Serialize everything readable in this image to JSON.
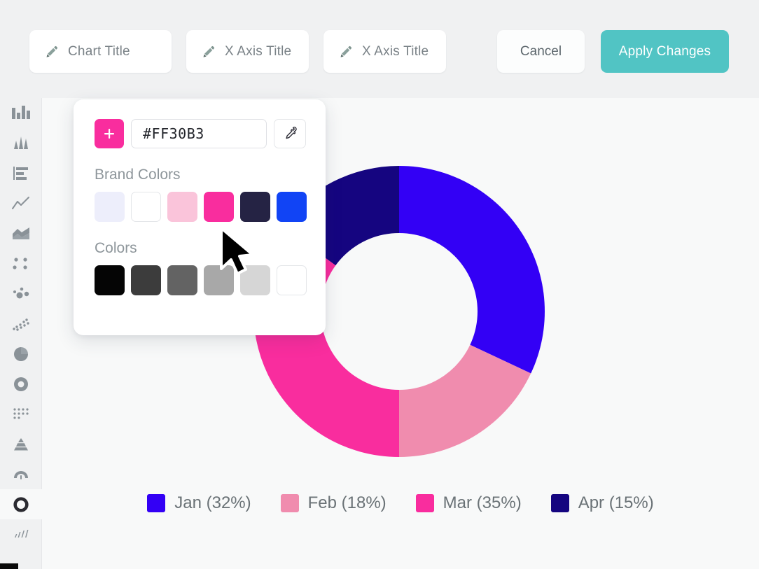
{
  "toolbar": {
    "chart_title": {
      "label": "Chart Title",
      "icon": "pencil-icon"
    },
    "x_axis_title_1": {
      "label": "X Axis Title",
      "icon": "pencil-icon"
    },
    "x_axis_title_2": {
      "label": "X Axis Title",
      "icon": "pencil-icon"
    },
    "cancel_label": "Cancel",
    "apply_label": "Apply Changes",
    "apply_color": "#51C4C4"
  },
  "sidebar": {
    "items": [
      {
        "name": "bar-chart",
        "selected": false
      },
      {
        "name": "histogram-chart",
        "selected": false
      },
      {
        "name": "horizontal-bar-chart",
        "selected": false
      },
      {
        "name": "line-chart",
        "selected": false
      },
      {
        "name": "area-chart",
        "selected": false
      },
      {
        "name": "dot-plot-chart",
        "selected": false
      },
      {
        "name": "bubble-chart",
        "selected": false
      },
      {
        "name": "scatter-chart",
        "selected": false
      },
      {
        "name": "pie-chart",
        "selected": false
      },
      {
        "name": "donut-chart",
        "selected": false
      },
      {
        "name": "dot-matrix-chart",
        "selected": false
      },
      {
        "name": "pyramid-chart",
        "selected": false
      },
      {
        "name": "gauge-chart",
        "selected": false
      },
      {
        "name": "ring-chart",
        "selected": true
      },
      {
        "name": "sparkline-chart",
        "selected": false
      }
    ]
  },
  "color_picker": {
    "hex_value": "#FF30B3",
    "hex_placeholder": "#FFFFFF",
    "add_button_color": "#F92D9E",
    "eyedropper_icon": "eyedropper-icon",
    "brand_colors_label": "Brand Colors",
    "brand_colors": [
      "#EDEEFB",
      "#FFFFFF",
      "#FAC4DA",
      "#F92D9E",
      "#252344",
      "#1144F5"
    ],
    "colors_label": "Colors",
    "colors": [
      "#050505",
      "#3C3C3C",
      "#636363",
      "#A8A8A8",
      "#D6D6D6",
      "#FFFFFF"
    ]
  },
  "chart_data": {
    "type": "pie",
    "variant": "donut",
    "title": "",
    "labels": [
      "Jan",
      "Feb",
      "Mar",
      "Apr"
    ],
    "values": [
      32,
      18,
      35,
      15
    ],
    "unit": "%",
    "colors": [
      "#3300F5",
      "#F08CAE",
      "#F92D9E",
      "#150580"
    ],
    "legend": {
      "position": "bottom",
      "entries": [
        {
          "label": "Jan (32%)",
          "color": "#3300F5"
        },
        {
          "label": "Feb (18%)",
          "color": "#F08CAE"
        },
        {
          "label": "Mar (35%)",
          "color": "#F92D9E"
        },
        {
          "label": "Apr (15%)",
          "color": "#150580"
        }
      ]
    },
    "start_angle": 0,
    "direction": "clockwise",
    "inner_radius_ratio": 0.53
  }
}
